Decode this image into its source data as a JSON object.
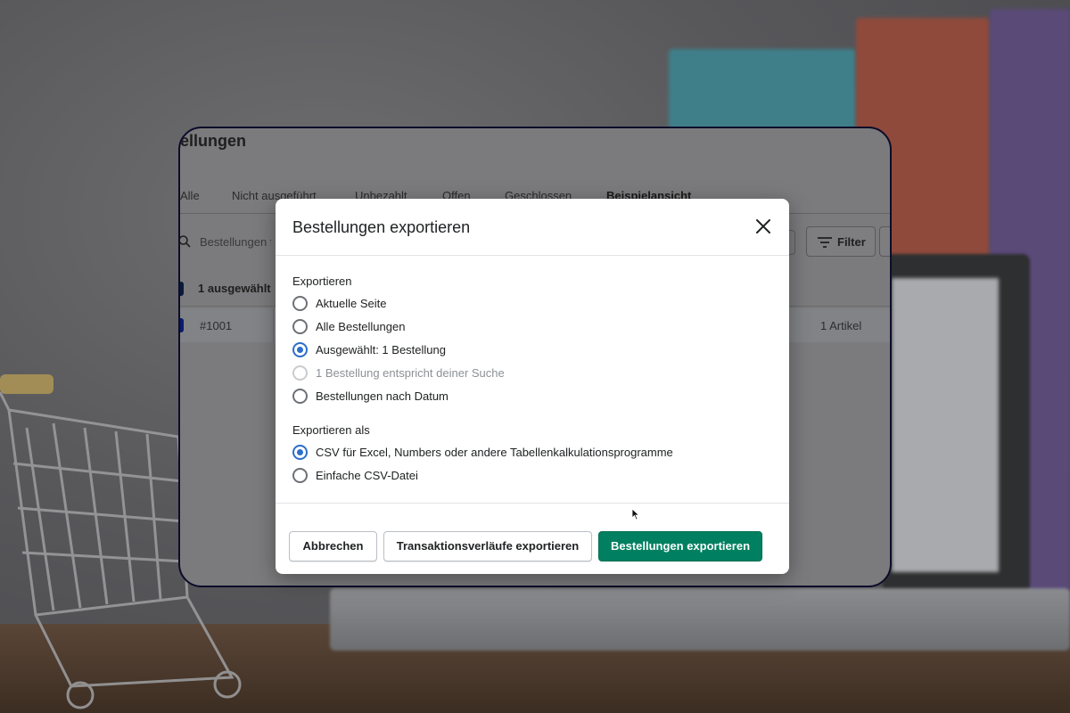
{
  "page": {
    "title": "ellungen",
    "tabs": [
      "Alle",
      "Nicht ausgeführt",
      "Unbezahlt",
      "Offen",
      "Geschlossen",
      "Beispielansicht"
    ],
    "active_tab": "Beispielansicht",
    "search_placeholder": "Bestellungen f",
    "filter_label": "Filter",
    "selected_count_label": "1 ausgewählt",
    "order": {
      "id": "#1001",
      "items": "1 Artikel"
    }
  },
  "modal": {
    "title": "Bestellungen exportieren",
    "export_section_label": "Exportieren",
    "export_options": [
      {
        "label": "Aktuelle Seite",
        "checked": false,
        "disabled": false
      },
      {
        "label": "Alle Bestellungen",
        "checked": false,
        "disabled": false
      },
      {
        "label": "Ausgewählt: 1 Bestellung",
        "checked": true,
        "disabled": false
      },
      {
        "label": "1 Bestellung entspricht deiner Suche",
        "checked": false,
        "disabled": true
      },
      {
        "label": "Bestellungen nach Datum",
        "checked": false,
        "disabled": false
      }
    ],
    "format_section_label": "Exportieren als",
    "format_options": [
      {
        "label": "CSV für Excel, Numbers oder andere Tabellenkalkulationsprogramme",
        "checked": true,
        "disabled": false
      },
      {
        "label": "Einfache CSV-Datei",
        "checked": false,
        "disabled": false
      }
    ],
    "buttons": {
      "cancel": "Abbrechen",
      "export_transactions": "Transaktionsverläufe exportieren",
      "export_orders": "Bestellungen exportieren"
    }
  },
  "colors": {
    "primary_button": "#008060",
    "radio_checked": "#2c6ecb",
    "overlay": "#7b7b7d"
  }
}
